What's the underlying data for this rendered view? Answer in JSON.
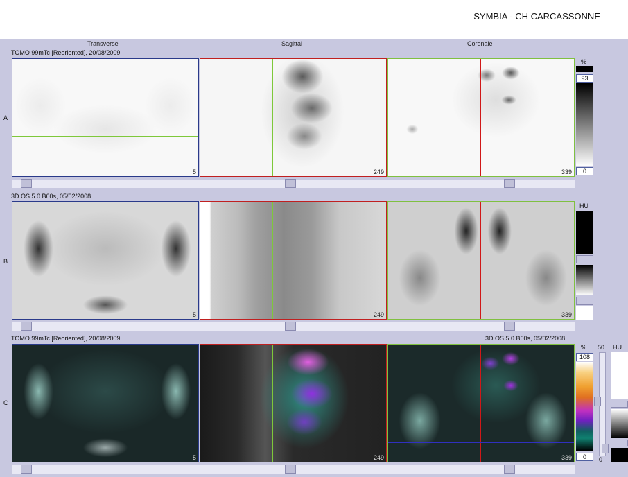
{
  "header": {
    "site": "SYMBIA - CH CARCASSONNE"
  },
  "columns": [
    "Transverse",
    "Sagittal",
    "Coronale"
  ],
  "rows": [
    {
      "letter": "A",
      "series": "TOMO 99mTc [Reoriented], 20/08/2009",
      "series_right": ""
    },
    {
      "letter": "B",
      "series": "3D  OS  5.0  B60s, 05/02/2008",
      "series_right": ""
    },
    {
      "letter": "C",
      "series": "TOMO 99mTc [Reoriented], 20/08/2009",
      "series_right": "3D  OS  5.0  B60s, 05/02/2008"
    }
  ],
  "slice_numbers": {
    "A": [
      "5",
      "249",
      "339"
    ],
    "B": [
      "5",
      "249",
      "339"
    ],
    "C": [
      "5",
      "249",
      "339"
    ]
  },
  "scales": {
    "A": {
      "unit": "%",
      "max": "93",
      "min": "0"
    },
    "B": {
      "unit": "HU"
    },
    "C": {
      "unit_pct": "%",
      "max": "108",
      "min": "0",
      "mid": "50",
      "unit_hu": "HU",
      "low": "0"
    }
  },
  "colors": {
    "background": "#c8c8e0",
    "transverse_border": "#2a3a8a",
    "sagittal_border": "#c02020",
    "coronal_border": "#80c040",
    "crosshair_red": "#d01818",
    "crosshair_green": "#7ec83a",
    "crosshair_blue": "#3030c0"
  }
}
